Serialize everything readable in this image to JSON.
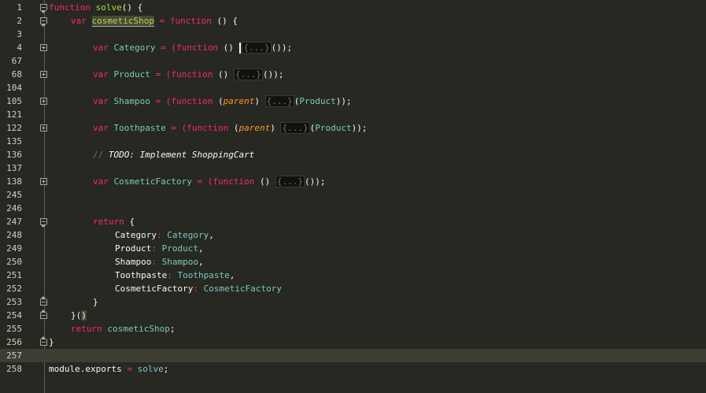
{
  "editor": {
    "lines": [
      {
        "n": "1"
      },
      {
        "n": "2"
      },
      {
        "n": "3"
      },
      {
        "n": "4"
      },
      {
        "n": "67"
      },
      {
        "n": "68"
      },
      {
        "n": "104"
      },
      {
        "n": "105"
      },
      {
        "n": "121"
      },
      {
        "n": "122"
      },
      {
        "n": "135"
      },
      {
        "n": "136"
      },
      {
        "n": "137"
      },
      {
        "n": "138"
      },
      {
        "n": "245"
      },
      {
        "n": "246"
      },
      {
        "n": "247"
      },
      {
        "n": "248"
      },
      {
        "n": "249"
      },
      {
        "n": "250"
      },
      {
        "n": "251"
      },
      {
        "n": "252"
      },
      {
        "n": "253"
      },
      {
        "n": "254"
      },
      {
        "n": "255"
      },
      {
        "n": "256"
      },
      {
        "n": "257"
      },
      {
        "n": "258"
      }
    ],
    "code": {
      "l1_kw": "function",
      "l1_name": "solve",
      "l1_rest": "() {",
      "l2_var": "var",
      "l2_name": "cosmeticShop",
      "l2_eq": " = ",
      "l2_fn": "function",
      "l2_rest": " () {",
      "l4_var": "var",
      "l4_name": "Category",
      "l4_eq": " = (",
      "l4_fn": "function",
      "l4_rest": " () ",
      "l4_fold": "{...}",
      "l4_end": "());",
      "l68_var": "var",
      "l68_name": "Product",
      "l68_eq": " = (",
      "l68_fn": "function",
      "l68_rest": " () ",
      "l68_fold": "{...}",
      "l68_end": "());",
      "l105_var": "var",
      "l105_name": "Shampoo",
      "l105_eq": " = (",
      "l105_fn": "function",
      "l105_open": " (",
      "l105_param": "parent",
      "l105_close": ") ",
      "l105_fold": "{...}",
      "l105_end_open": "(",
      "l105_arg": "Product",
      "l105_end": "));",
      "l122_var": "var",
      "l122_name": "Toothpaste",
      "l122_eq": " = (",
      "l122_fn": "function",
      "l122_open": " (",
      "l122_param": "parent",
      "l122_close": ") ",
      "l122_fold": "{...}",
      "l122_end_open": "(",
      "l122_arg": "Product",
      "l122_end": "));",
      "l136_slash": "// ",
      "l136_todo": "TODO: Implement ShoppingCart",
      "l138_var": "var",
      "l138_name": "CosmeticFactory",
      "l138_eq": " = (",
      "l138_fn": "function",
      "l138_rest": " () ",
      "l138_fold": "{...}",
      "l138_end": "());",
      "l247_kw": "return",
      "l247_rest": " {",
      "l248_key": "Category",
      "l248_colon": ": ",
      "l248_val": "Category",
      "l248_end": ",",
      "l249_key": "Product",
      "l249_colon": ": ",
      "l249_val": "Product",
      "l249_end": ",",
      "l250_key": "Shampoo",
      "l250_colon": ": ",
      "l250_val": "Shampoo",
      "l250_end": ",",
      "l251_key": "Toothpaste",
      "l251_colon": ": ",
      "l251_val": "Toothpaste",
      "l251_end": ",",
      "l252_key": "CosmeticFactory",
      "l252_colon": ": ",
      "l252_val": "CosmeticFactory",
      "l253": "}",
      "l254_a": "}(",
      "l254_b": ")",
      "l255_kw": "return",
      "l255_val": " cosmeticShop",
      "l255_end": ";",
      "l256": "}",
      "l258_mod": "module",
      "l258_dot": ".",
      "l258_exp": "exports",
      "l258_eq": " = ",
      "l258_val": "solve",
      "l258_end": ";"
    }
  },
  "colors": {
    "background": "#272822",
    "keyword": "#f92672",
    "function_name": "#a6e22e",
    "identifier": "#7ec7c2",
    "parameter": "#fd971f",
    "comment": "#75715e"
  }
}
